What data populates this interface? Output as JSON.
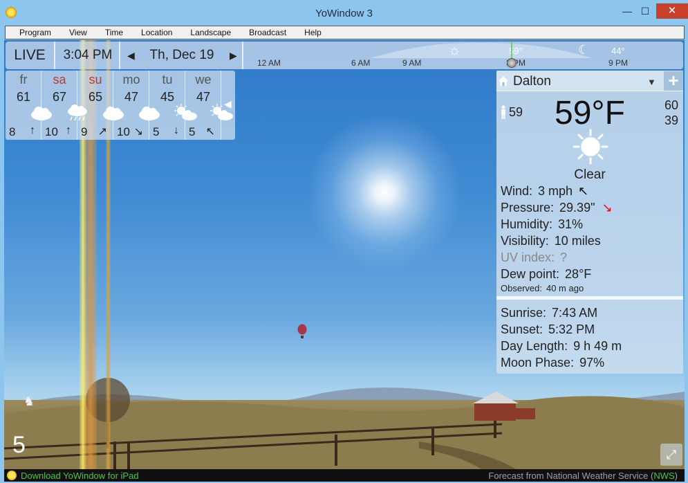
{
  "window": {
    "title": "YoWindow 3",
    "min_label": "—",
    "max_label": "☐",
    "close_label": "✕"
  },
  "menu": [
    "Program",
    "View",
    "Time",
    "Location",
    "Landscape",
    "Broadcast",
    "Help"
  ],
  "timebar": {
    "live": "LIVE",
    "time": "3:04 PM",
    "date": "Th, Dec 19",
    "prev_icon": "left-arrow-icon",
    "next_icon": "right-arrow-icon",
    "labels": [
      "12 AM",
      "6 AM",
      "9 AM",
      "3 PM",
      "9 PM"
    ],
    "temps": [
      "59°",
      "44°"
    ]
  },
  "forecast": [
    {
      "day": "fr",
      "temp": "61",
      "icon": "cloud-icon",
      "wind": "8",
      "dir": "↑",
      "weekend": false
    },
    {
      "day": "sa",
      "temp": "67",
      "icon": "rain-cloud-icon",
      "wind": "10",
      "dir": "↑",
      "weekend": true
    },
    {
      "day": "su",
      "temp": "65",
      "icon": "cloud-icon",
      "wind": "9",
      "dir": "↗",
      "weekend": true
    },
    {
      "day": "mo",
      "temp": "47",
      "icon": "cloud-icon",
      "wind": "10",
      "dir": "↘",
      "weekend": false
    },
    {
      "day": "tu",
      "temp": "45",
      "icon": "partly-sunny-icon",
      "wind": "5",
      "dir": "↓",
      "weekend": false
    },
    {
      "day": "we",
      "temp": "47",
      "icon": "partly-sunny-icon",
      "wind": "5",
      "dir": "↖",
      "weekend": false
    }
  ],
  "current": {
    "city": "Dalton",
    "feels_like": "59",
    "temp": "59°F",
    "high": "60",
    "low": "39",
    "condition": "Clear",
    "wind_label": "Wind:",
    "wind": "3 mph",
    "pressure_label": "Pressure:",
    "pressure": "29.39\"",
    "humidity_label": "Humidity:",
    "humidity": "31%",
    "visibility_label": "Visibility:",
    "visibility": "10 miles",
    "uv_label": "UV index:",
    "uv": "?",
    "dew_label": "Dew point:",
    "dew": "28°F",
    "observed_label": "Observed:",
    "observed": "40 m ago",
    "sunrise_label": "Sunrise:",
    "sunrise": "7:43 AM",
    "sunset_label": "Sunset:",
    "sunset": "5:32 PM",
    "daylength_label": "Day Length:",
    "daylength": "9 h 49 m",
    "moon_label": "Moon Phase:",
    "moon": "97%"
  },
  "status": {
    "left": "Download YoWindow for iPad",
    "right_prefix": "Forecast from National Weather Service (",
    "right_nws": "NWS",
    "right_suffix": ")"
  },
  "badge": "5",
  "colors": {
    "weekend": "#c0392b",
    "sky_top": "#2f79c7",
    "status_green": "#4cc54c",
    "pressure_arrow": "#dd1111"
  }
}
